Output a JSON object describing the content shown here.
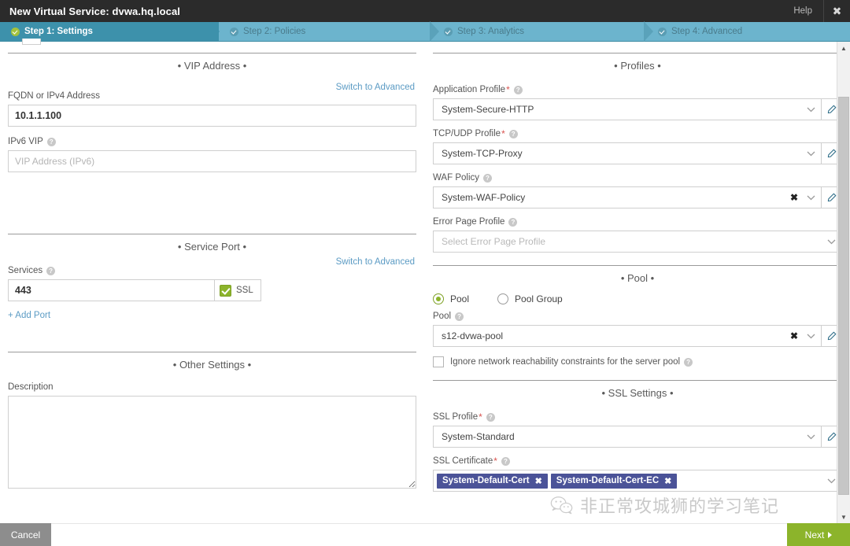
{
  "titlebar": {
    "title": "New Virtual Service: dvwa.hq.local",
    "help_label": "Help",
    "close_label": "✖"
  },
  "steps": [
    {
      "label": "Step 1: Settings",
      "active": true
    },
    {
      "label": "Step 2: Policies",
      "active": false
    },
    {
      "label": "Step 3: Analytics",
      "active": false
    },
    {
      "label": "Step 4: Advanced",
      "active": false
    }
  ],
  "sections": {
    "vip_address": {
      "title": "• VIP Address •",
      "switch_link": "Switch to Advanced",
      "fqdn_label": "FQDN or IPv4 Address",
      "fqdn_value": "10.1.1.100",
      "ipv6_label": "IPv6 VIP",
      "ipv6_placeholder": "VIP Address (IPv6)"
    },
    "service_port": {
      "title": "• Service Port •",
      "switch_link": "Switch to Advanced",
      "services_label": "Services",
      "port_value": "443",
      "ssl_label": "SSL",
      "ssl_checked": true,
      "add_port_label": "+ Add Port"
    },
    "other_settings": {
      "title": "• Other Settings •",
      "description_label": "Description",
      "description_value": ""
    },
    "profiles": {
      "title": "• Profiles •",
      "application_profile_label": "Application Profile",
      "application_profile_value": "System-Secure-HTTP",
      "tcp_udp_profile_label": "TCP/UDP Profile",
      "tcp_udp_profile_value": "System-TCP-Proxy",
      "waf_policy_label": "WAF Policy",
      "waf_policy_value": "System-WAF-Policy",
      "error_page_profile_label": "Error Page Profile",
      "error_page_profile_placeholder": "Select Error Page Profile"
    },
    "pool": {
      "title": "• Pool •",
      "radio_pool_label": "Pool",
      "radio_pool_group_label": "Pool Group",
      "selected_radio": "Pool",
      "pool_label": "Pool",
      "pool_value": "s12-dvwa-pool",
      "ignore_checkbox_label": "Ignore network reachability constraints for the server pool",
      "ignore_checked": false
    },
    "ssl_settings": {
      "title": "• SSL Settings •",
      "ssl_profile_label": "SSL Profile",
      "ssl_profile_value": "System-Standard",
      "ssl_certificate_label": "SSL Certificate",
      "ssl_certificates": [
        {
          "name": "System-Default-Cert"
        },
        {
          "name": "System-Default-Cert-EC"
        }
      ]
    }
  },
  "footer": {
    "cancel_label": "Cancel",
    "next_label": "Next"
  },
  "watermark": {
    "text": "非正常攻城狮的学习笔记"
  },
  "colors": {
    "accent_teal": "#3d91ab",
    "stepbar": "#6cb4cd",
    "green": "#8cb42b",
    "link_blue": "#5b9bc4",
    "tag_purple": "#4b5398",
    "required_red": "#d9534f",
    "titlebar_dark": "#2b2b2b"
  }
}
